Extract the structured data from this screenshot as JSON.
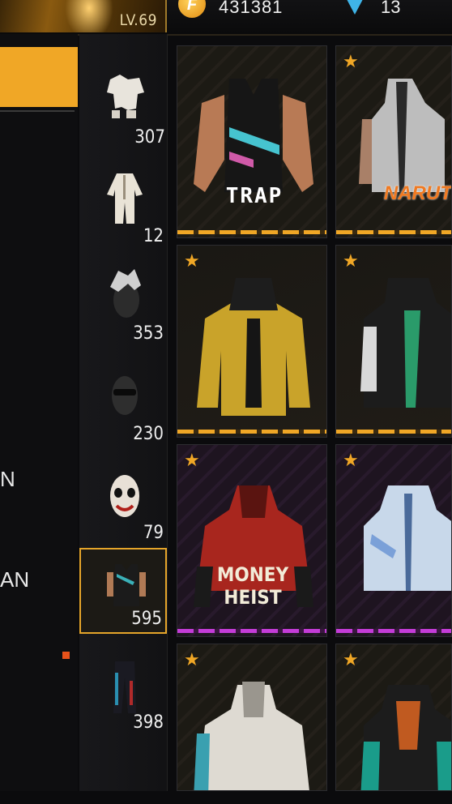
{
  "header": {
    "level": "LV.69",
    "gold_symbol": "F",
    "gold_amount": "431381",
    "diamond_amount": "13"
  },
  "left_panel": {
    "labels": [
      "N",
      "AN"
    ]
  },
  "icon_column": {
    "items": [
      {
        "name": "outfit-set",
        "count": "307"
      },
      {
        "name": "jumpsuit",
        "count": "12"
      },
      {
        "name": "hair",
        "count": "353"
      },
      {
        "name": "face-mask-glasses",
        "count": "230"
      },
      {
        "name": "mask",
        "count": "79"
      },
      {
        "name": "top",
        "count": "595",
        "selected": true
      },
      {
        "name": "bottom",
        "count": "398"
      }
    ]
  },
  "grid": {
    "cards": [
      {
        "brand": "TRAP",
        "starred": false,
        "accent": "#f0a726"
      },
      {
        "brand": "NARUTO",
        "starred": true,
        "accent": "#f0a726"
      },
      {
        "brand": "",
        "starred": true,
        "accent": "#f0a726"
      },
      {
        "brand": "",
        "starred": true,
        "accent": "#f0a726"
      },
      {
        "brand": "MONEY HEIST",
        "starred": true,
        "accent": "#c43cd8"
      },
      {
        "brand": "",
        "starred": true,
        "accent": "#c43cd8"
      },
      {
        "brand": "",
        "starred": true,
        "accent": "#f0a726"
      },
      {
        "brand": "",
        "starred": true,
        "accent": "#f0a726"
      }
    ]
  },
  "colors": {
    "accent_gold": "#f0a726",
    "accent_purple": "#c43cd8",
    "selection": "#e5a52a"
  }
}
